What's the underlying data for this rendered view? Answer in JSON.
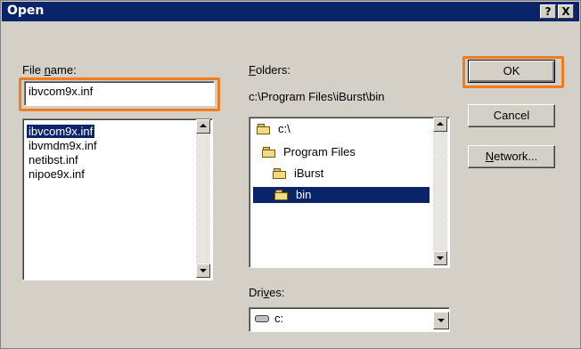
{
  "window": {
    "title": "Open",
    "help_btn": "?",
    "close_btn": "X"
  },
  "file_name": {
    "label_pre": "File ",
    "label_acc": "n",
    "label_post": "ame:",
    "value": "ibvcom9x.inf",
    "files": [
      "ibvcom9x.inf",
      "ibvmdm9x.inf",
      "netibst.inf",
      "nipoe9x.inf"
    ],
    "selected_index": 0
  },
  "folders": {
    "label_acc": "F",
    "label_post": "olders:",
    "current_path": "c:\\Program Files\\iBurst\\bin",
    "tree": [
      "c:\\",
      "Program Files",
      "iBurst",
      "bin"
    ],
    "selected_index": 3
  },
  "drives": {
    "label_pre": "Dri",
    "label_acc": "v",
    "label_post": "es:",
    "value": "c:"
  },
  "buttons": {
    "ok": "OK",
    "cancel": "Cancel",
    "network_pre": "",
    "network_acc": "N",
    "network_post": "etwork..."
  },
  "highlight_color": "#f07c1c"
}
